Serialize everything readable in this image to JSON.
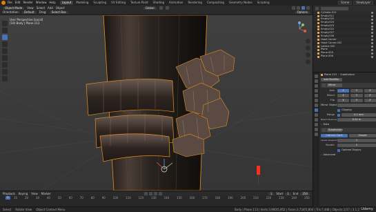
{
  "top_menu": {
    "items": [
      "File",
      "Edit",
      "Render",
      "Window",
      "Help"
    ],
    "tabs": [
      "Layout",
      "Modeling",
      "Sculpting",
      "UV Editing",
      "Texture Paint",
      "Shading",
      "Animation",
      "Rendering",
      "Compositing",
      "Geometry Nodes",
      "Scripting"
    ],
    "active_tab": "Layout",
    "scene_label": "Scene",
    "view_layer_label": "ViewLayer"
  },
  "viewport_header": {
    "mode": "Object Mode",
    "menus": [
      "View",
      "Select",
      "Add",
      "Object"
    ],
    "shading_label": "Global",
    "options_label": "Options",
    "orientation_label": "Orientation:",
    "orientation_value": "Default",
    "drag_label": "Drag:",
    "drag_value": "Select Box"
  },
  "viewport_overlay": {
    "view_name": "User Perspective (Local)",
    "object_info": "(18) Body | Plane.113"
  },
  "outliner": {
    "items": [
      "Cylinder.012",
      "Empty.011",
      "Empty.025",
      "Empty.024",
      "Empty.023",
      "Empty.022",
      "Empty.027",
      "Empty.026",
      "Hood Corner",
      "Hood Corner.002",
      "Lattice.002",
      "Plane",
      "Plane.005",
      "Plane.006"
    ]
  },
  "properties": {
    "object_name": "Plane.113",
    "modifier_label": "Subdivision",
    "add_modifier": "Add Modifier",
    "mirror_name": "Mirror",
    "axis_label": "Axis",
    "bisect_label": "Bisect",
    "flip_label": "Flip",
    "axes": [
      "X",
      "Y",
      "Z"
    ],
    "mirror_object_label": "Mirror Object",
    "clipping_label": "Clipping",
    "merge_label": "Merge",
    "merge_value": "0.1 mm",
    "bisect_distance_label": "Bisect Distance",
    "bisect_distance_value": "0.01 m",
    "data_label": "Data",
    "subdiv_name": "Subdivision",
    "catmull_label": "Catmull-Clark",
    "simple_label": "Simple",
    "levels_viewport_label": "Levels Viewport",
    "levels_viewport_value": "1",
    "render_label": "Render",
    "render_value": "2",
    "optimal_display_label": "Optimal Display",
    "advanced_label": "Advanced"
  },
  "timeline": {
    "menus": [
      "Playback",
      "Keying",
      "View",
      "Marker"
    ],
    "current_frame": "1",
    "start_label": "Start",
    "start_value": "1",
    "end_label": "End",
    "end_value": "250",
    "ticks": [
      "10",
      "20",
      "30",
      "40",
      "50",
      "60",
      "70",
      "80",
      "90",
      "100",
      "110",
      "120",
      "130",
      "140",
      "150",
      "160",
      "170",
      "180",
      "190",
      "200",
      "210",
      "220",
      "230",
      "240",
      "250"
    ]
  },
  "status_bar": {
    "select": "Select",
    "rotate": "Rotate View",
    "context_menu": "Object Context Menu",
    "stats": "Body | Plane.113 | Verts:3,960/5,952 | Faces:3,724/5,804 | Tris:7,448 | Objects:1/27 | 3.1.2"
  },
  "watermark": "Udemy",
  "colors": {
    "accent": "#4772b3",
    "selection_outline": "#e8901f",
    "viewport_bg": "#3a3a3a"
  }
}
